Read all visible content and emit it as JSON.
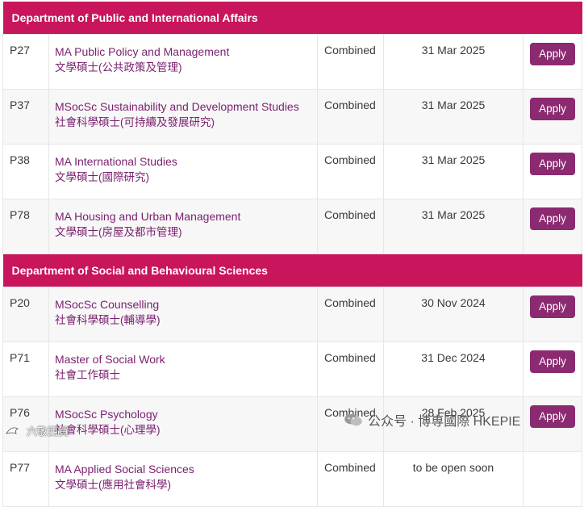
{
  "colors": {
    "dept_header": "#c8155c",
    "apply_button": "#8b2a70",
    "program_link": "#7a1f6e"
  },
  "sections": [
    {
      "department": "Department of Public and International Affairs",
      "programmes": [
        {
          "code": "P27",
          "name_en": "MA Public Policy and Management",
          "name_zh": "文學碩士(公共政策及管理)",
          "mode": "Combined",
          "deadline": "31 Mar 2025",
          "action": "Apply"
        },
        {
          "code": "P37",
          "name_en": "MSocSc Sustainability and Development Studies",
          "name_zh": "社會科學碩士(可持續及發展研究)",
          "mode": "Combined",
          "deadline": "31 Mar 2025",
          "action": "Apply"
        },
        {
          "code": "P38",
          "name_en": "MA International Studies",
          "name_zh": "文學碩士(國際研究)",
          "mode": "Combined",
          "deadline": "31 Mar 2025",
          "action": "Apply"
        },
        {
          "code": "P78",
          "name_en": "MA Housing and Urban Management",
          "name_zh": "文學碩士(房屋及都市管理)",
          "mode": "Combined",
          "deadline": "31 Mar 2025",
          "action": "Apply"
        }
      ]
    },
    {
      "department": "Department of Social and Behavioural Sciences",
      "programmes": [
        {
          "code": "P20",
          "name_en": "MSocSc Counselling",
          "name_zh": "社會科學碩士(輔導學)",
          "mode": "Combined",
          "deadline": "30 Nov 2024",
          "action": "Apply"
        },
        {
          "code": "P71",
          "name_en": "Master of Social Work",
          "name_zh": "社會工作碩士",
          "mode": "Combined",
          "deadline": "31 Dec 2024",
          "action": "Apply"
        },
        {
          "code": "P76",
          "name_en": "MSocSc Psychology",
          "name_zh": "社會科學碩士(心理學)",
          "mode": "Combined",
          "deadline": "28 Feb 2025",
          "action": "Apply"
        },
        {
          "code": "P77",
          "name_en": "MA Applied Social Sciences",
          "name_zh": "文學碩士(應用社會科學)",
          "mode": "Combined",
          "deadline": "to be open soon",
          "action": ""
        }
      ]
    }
  ],
  "watermarks": {
    "left": "六敬西賀",
    "right": "公众号 · 博専國際 HKEPIE"
  }
}
